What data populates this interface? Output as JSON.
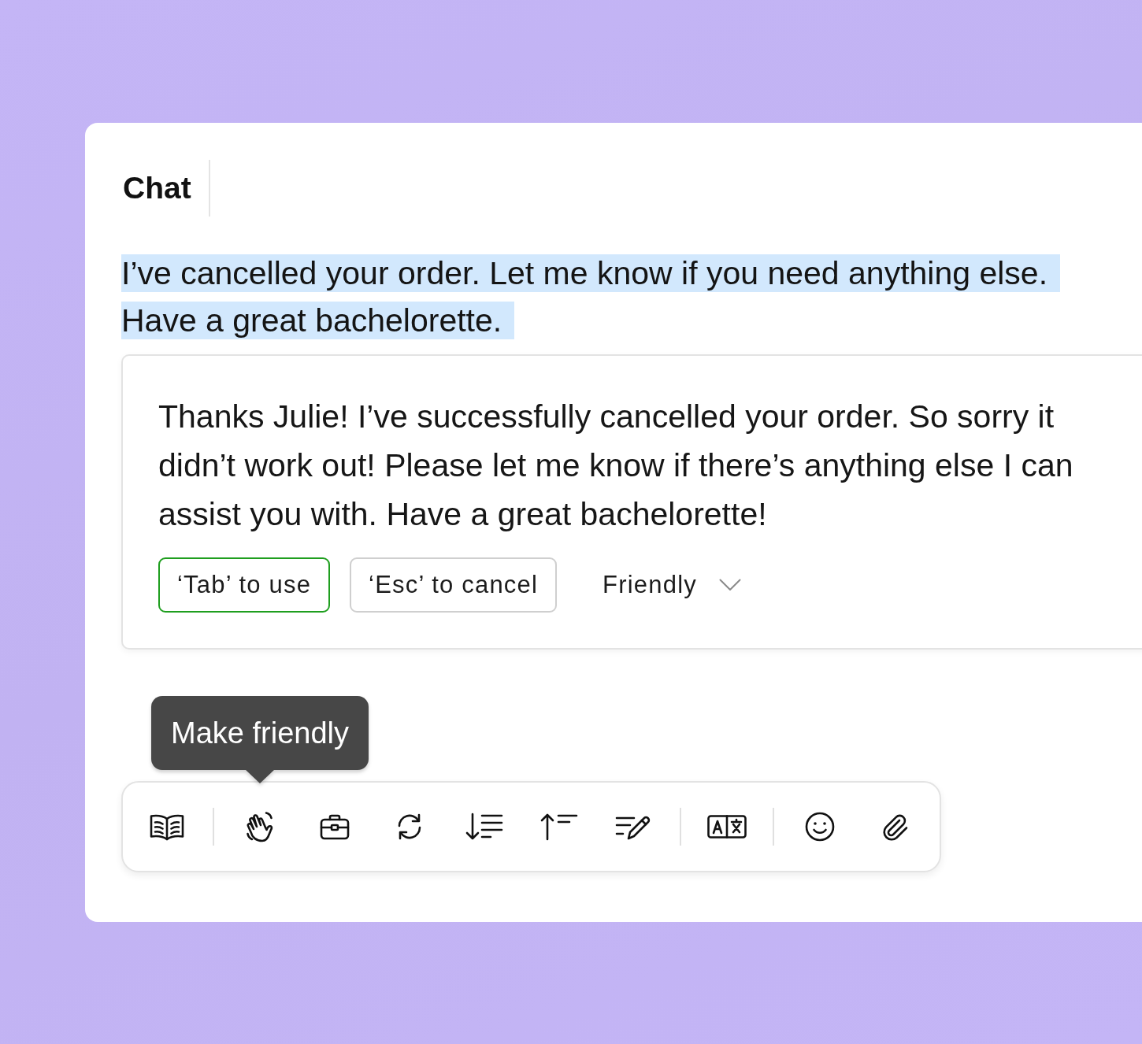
{
  "header": {
    "title": "Chat"
  },
  "draft": {
    "text": "I’ve cancelled your order. Let me know if you need anything else. Have a great bachelorette.",
    "selected": true
  },
  "suggestion": {
    "text": "Thanks Julie! I’ve successfully cancelled your order. So sorry it didn’t work out! Please let me know if there’s anything else I can assist you with. Have a great bachelorette!",
    "actions": [
      {
        "label": "‘Tab’ to use",
        "kind": "primary"
      },
      {
        "label": "‘Esc’ to cancel",
        "kind": "secondary"
      }
    ],
    "tone": {
      "value": "Friendly"
    }
  },
  "toolbar": {
    "tooltip": "Make friendly"
  }
}
